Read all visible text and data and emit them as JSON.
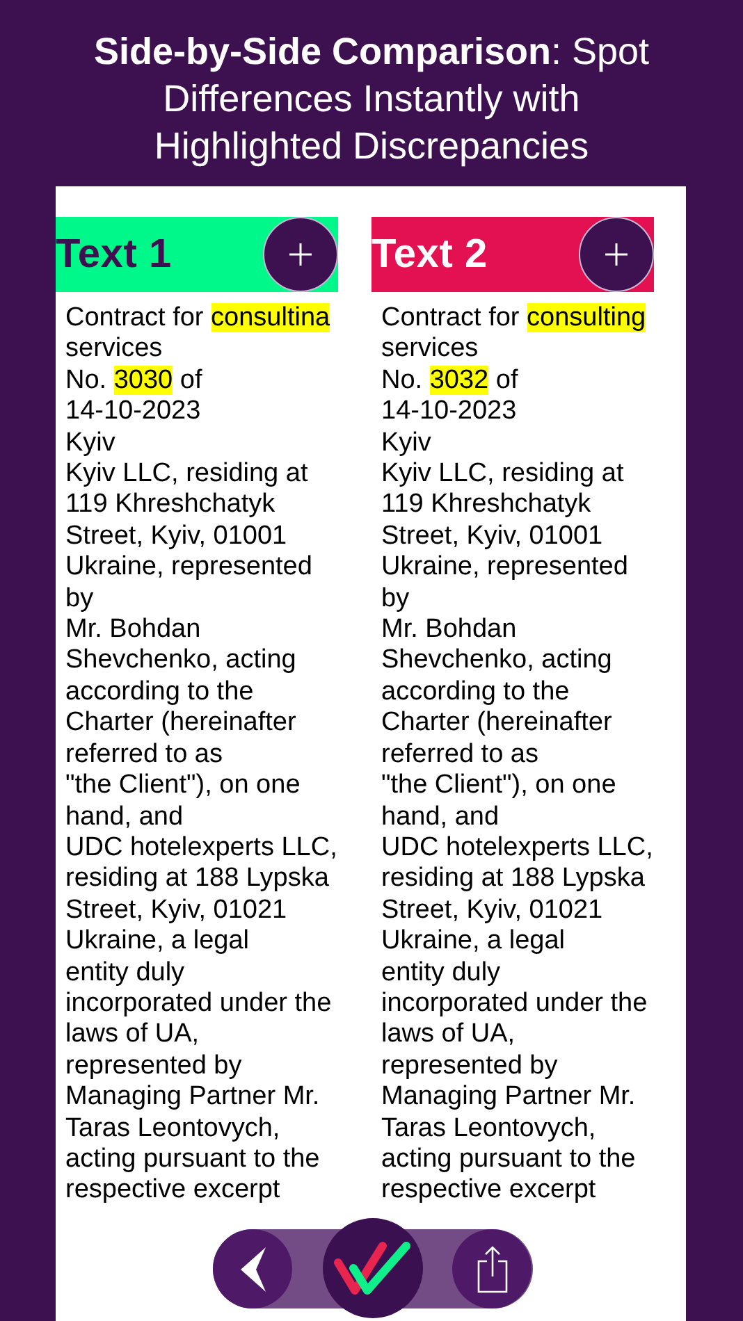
{
  "headline": {
    "lead": "Side-by-Side Comparison",
    "rest": ": Spot Differences Instantly with Highlighted Discrepancies"
  },
  "documents": [
    {
      "title": "Text 1",
      "color": "#00f78a",
      "lines": [
        [
          {
            "text": "Contract for ",
            "highlighted": false
          },
          {
            "text": "consultina",
            "highlighted": true
          }
        ],
        [
          {
            "text": "services",
            "highlighted": false
          }
        ],
        [
          {
            "text": "No. ",
            "highlighted": false
          },
          {
            "text": "3030",
            "highlighted": true
          },
          {
            "text": " of",
            "highlighted": false
          }
        ],
        [
          {
            "text": "14-10-2023",
            "highlighted": false
          }
        ],
        [
          {
            "text": "Kyiv",
            "highlighted": false
          }
        ],
        [
          {
            "text": "Kyiv LLC, residing at",
            "highlighted": false
          }
        ],
        [
          {
            "text": "119 Khreshchatyk",
            "highlighted": false
          }
        ],
        [
          {
            "text": "Street, Kyiv, 01001",
            "highlighted": false
          }
        ],
        [
          {
            "text": "Ukraine, represented",
            "highlighted": false
          }
        ],
        [
          {
            "text": "by",
            "highlighted": false
          }
        ],
        [
          {
            "text": "Mr. Bohdan",
            "highlighted": false
          }
        ],
        [
          {
            "text": "Shevchenko, acting",
            "highlighted": false
          }
        ],
        [
          {
            "text": "according to the",
            "highlighted": false
          }
        ],
        [
          {
            "text": "Charter (hereinafter",
            "highlighted": false
          }
        ],
        [
          {
            "text": "referred to as",
            "highlighted": false
          }
        ],
        [
          {
            "text": "\"the Client\"), on one",
            "highlighted": false
          }
        ],
        [
          {
            "text": "hand, and",
            "highlighted": false
          }
        ],
        [
          {
            "text": "UDC hotelexperts LLC,",
            "highlighted": false
          }
        ],
        [
          {
            "text": "residing at 188 Lypska",
            "highlighted": false
          }
        ],
        [
          {
            "text": "Street, Kyiv, 01021",
            "highlighted": false
          }
        ],
        [
          {
            "text": "Ukraine, a legal",
            "highlighted": false
          }
        ],
        [
          {
            "text": "entity duly",
            "highlighted": false
          }
        ],
        [
          {
            "text": "incorporated under the",
            "highlighted": false
          }
        ],
        [
          {
            "text": "laws of UA,",
            "highlighted": false
          }
        ],
        [
          {
            "text": "represented by",
            "highlighted": false
          }
        ],
        [
          {
            "text": "Managing Partner Mr.",
            "highlighted": false
          }
        ],
        [
          {
            "text": "Taras Leontovych,",
            "highlighted": false
          }
        ],
        [
          {
            "text": "acting pursuant to the",
            "highlighted": false
          }
        ],
        [
          {
            "text": "respective excerpt",
            "highlighted": false
          }
        ]
      ]
    },
    {
      "title": "Text 2",
      "color": "#e31152",
      "lines": [
        [
          {
            "text": "Contract for ",
            "highlighted": false
          },
          {
            "text": "consulting",
            "highlighted": true
          }
        ],
        [
          {
            "text": "services",
            "highlighted": false
          }
        ],
        [
          {
            "text": "No. ",
            "highlighted": false
          },
          {
            "text": "3032",
            "highlighted": true
          },
          {
            "text": " of",
            "highlighted": false
          }
        ],
        [
          {
            "text": "14-10-2023",
            "highlighted": false
          }
        ],
        [
          {
            "text": "Kyiv",
            "highlighted": false
          }
        ],
        [
          {
            "text": "Kyiv LLC, residing at",
            "highlighted": false
          }
        ],
        [
          {
            "text": "119 Khreshchatyk",
            "highlighted": false
          }
        ],
        [
          {
            "text": "Street, Kyiv, 01001",
            "highlighted": false
          }
        ],
        [
          {
            "text": "Ukraine, represented",
            "highlighted": false
          }
        ],
        [
          {
            "text": "by",
            "highlighted": false
          }
        ],
        [
          {
            "text": "Mr. Bohdan",
            "highlighted": false
          }
        ],
        [
          {
            "text": "Shevchenko, acting",
            "highlighted": false
          }
        ],
        [
          {
            "text": "according to the",
            "highlighted": false
          }
        ],
        [
          {
            "text": "Charter (hereinafter",
            "highlighted": false
          }
        ],
        [
          {
            "text": "referred to as",
            "highlighted": false
          }
        ],
        [
          {
            "text": "\"the Client\"), on one",
            "highlighted": false
          }
        ],
        [
          {
            "text": "hand, and",
            "highlighted": false
          }
        ],
        [
          {
            "text": "UDC hotelexperts LLC,",
            "highlighted": false
          }
        ],
        [
          {
            "text": "residing at 188 Lypska",
            "highlighted": false
          }
        ],
        [
          {
            "text": "Street, Kyiv, 01021",
            "highlighted": false
          }
        ],
        [
          {
            "text": "Ukraine, a legal",
            "highlighted": false
          }
        ],
        [
          {
            "text": "entity duly",
            "highlighted": false
          }
        ],
        [
          {
            "text": "incorporated under the",
            "highlighted": false
          }
        ],
        [
          {
            "text": "laws of UA,",
            "highlighted": false
          }
        ],
        [
          {
            "text": "represented by",
            "highlighted": false
          }
        ],
        [
          {
            "text": "Managing Partner Mr.",
            "highlighted": false
          }
        ],
        [
          {
            "text": "Taras Leontovych,",
            "highlighted": false
          }
        ],
        [
          {
            "text": "acting pursuant to the",
            "highlighted": false
          }
        ],
        [
          {
            "text": "respective excerpt",
            "highlighted": false
          }
        ]
      ]
    }
  ]
}
